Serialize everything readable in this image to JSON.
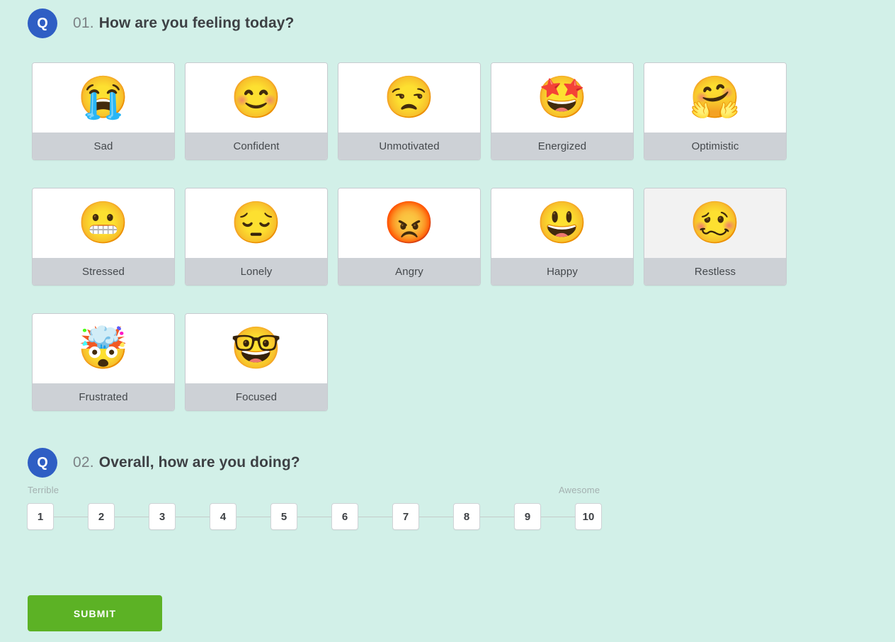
{
  "background_color": "#d2f0e8",
  "questions": [
    {
      "badge": "Q",
      "number": "01.",
      "text": "How are you feeling today?"
    },
    {
      "badge": "Q",
      "number": "02.",
      "text": "Overall, how are you doing?"
    }
  ],
  "mood_options": [
    {
      "label": "Sad",
      "emoji": "😭",
      "emoji_name": "loudly-crying-face",
      "hovered": false
    },
    {
      "label": "Confident",
      "emoji": "😊",
      "emoji_name": "smiling-face-with-smiling-eyes",
      "hovered": false
    },
    {
      "label": "Unmotivated",
      "emoji": "😒",
      "emoji_name": "unamused-face",
      "hovered": false
    },
    {
      "label": "Energized",
      "emoji": "🤩",
      "emoji_name": "star-struck-face",
      "hovered": false
    },
    {
      "label": "Optimistic",
      "emoji": "🤗",
      "emoji_name": "hugging-face",
      "hovered": false
    },
    {
      "label": "Stressed",
      "emoji": "😬",
      "emoji_name": "grimacing-face",
      "hovered": false
    },
    {
      "label": "Lonely",
      "emoji": "😔",
      "emoji_name": "pensive-face",
      "hovered": false
    },
    {
      "label": "Angry",
      "emoji": "😡",
      "emoji_name": "pouting-face",
      "hovered": false
    },
    {
      "label": "Happy",
      "emoji": "😃",
      "emoji_name": "grinning-face-with-big-eyes",
      "hovered": false
    },
    {
      "label": "Restless",
      "emoji": "🥴",
      "emoji_name": "woozy-face",
      "hovered": true
    },
    {
      "label": "Frustrated",
      "emoji": "🤯",
      "emoji_name": "exploding-head",
      "hovered": false
    },
    {
      "label": "Focused",
      "emoji": "🤓",
      "emoji_name": "nerd-face",
      "hovered": false
    }
  ],
  "rating_scale": {
    "low_label": "Terrible",
    "high_label": "Awesome",
    "values": [
      "1",
      "2",
      "3",
      "4",
      "5",
      "6",
      "7",
      "8",
      "9",
      "10"
    ],
    "selected": null
  },
  "submit": {
    "label": "SUBMIT",
    "color": "#5cb225"
  }
}
